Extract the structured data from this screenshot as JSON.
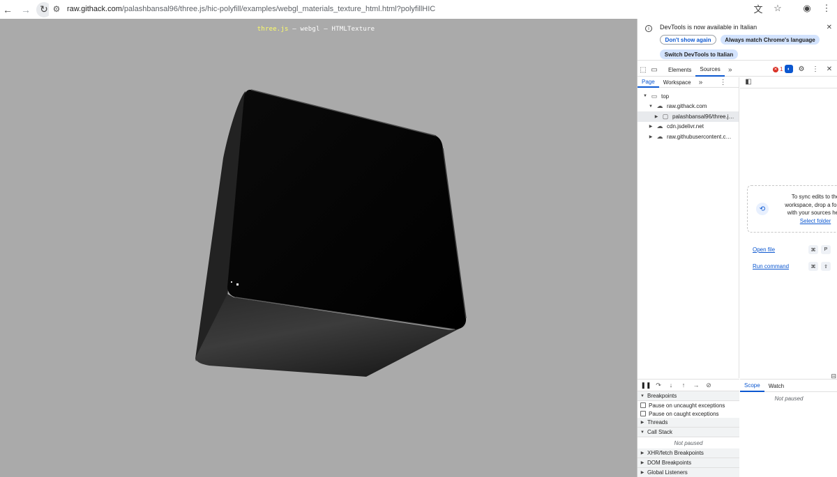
{
  "browser": {
    "url_host": "raw.githack.com",
    "url_path": "/palashbansal96/three.js/hic-polyfill/examples/webgl_materials_texture_html.html?polyfillHIC"
  },
  "page": {
    "info_lib": "three.js",
    "info_rest": " – webgl – HTMLTexture"
  },
  "devtools": {
    "infobar": {
      "message": "DevTools is now available in Italian",
      "dont_show": "Don't show again",
      "always_match": "Always match Chrome's language",
      "switch": "Switch DevTools to Italian"
    },
    "tabs": [
      "Elements",
      "Sources"
    ],
    "active_tab": "Sources",
    "error_count": "1",
    "subtabs": [
      "Page",
      "Workspace"
    ],
    "tree": [
      {
        "label": "top",
        "icon": "frame-icon"
      },
      {
        "label": "raw.githack.com",
        "icon": "cloud-icon"
      },
      {
        "label": "palashbansal96/three.j…",
        "icon": "folder-icon"
      },
      {
        "label": "cdn.jsdelivr.net",
        "icon": "cloud-icon"
      },
      {
        "label": "raw.githubusercontent.c…",
        "icon": "cloud-icon"
      }
    ],
    "sync": {
      "line1": "To sync edits to the",
      "line2": "workspace, drop a folder",
      "line3": "with your sources here",
      "link": "Select folder"
    },
    "open_file": "Open file",
    "open_file_keys": [
      "⌘",
      "P"
    ],
    "run_command": "Run command",
    "run_command_keys": [
      "⌘",
      "⇧"
    ],
    "breakpoints": "Breakpoints",
    "pause_uncaught": "Pause on uncaught exceptions",
    "pause_caught": "Pause on caught exceptions",
    "threads": "Threads",
    "call_stack": "Call Stack",
    "not_paused": "Not paused",
    "xhr": "XHR/fetch Breakpoints",
    "dom": "DOM Breakpoints",
    "global": "Global Listeners",
    "scope": "Scope",
    "watch": "Watch"
  }
}
